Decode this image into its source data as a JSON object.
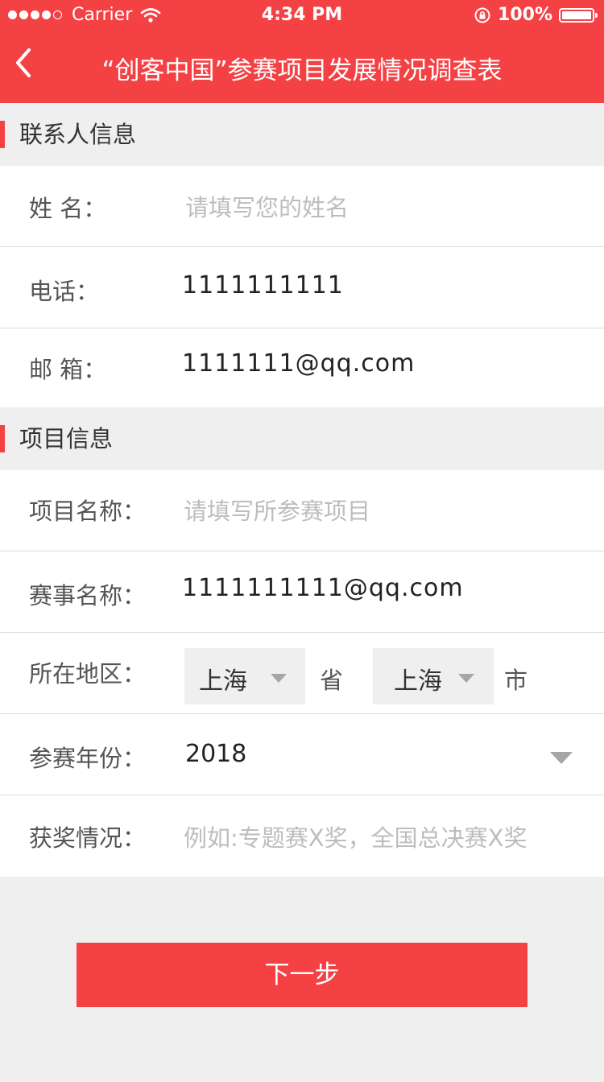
{
  "status_bar": {
    "carrier": "Carrier",
    "time": "4:34 PM",
    "battery": "100%"
  },
  "nav": {
    "title": "“创客中国”参赛项目发展情况调查表"
  },
  "contact_section": {
    "title": "联系人信息",
    "name_label": "姓 名：",
    "name_placeholder": "请填写您的姓名",
    "phone_label": "电话：",
    "phone_value": "1111111111",
    "email_label": "邮 箱：",
    "email_value": "1111111@qq.com"
  },
  "project_section": {
    "title": "项目信息",
    "project_name_label": "项目名称：",
    "project_name_placeholder": "请填写所参赛项目",
    "event_name_label": "赛事名称：",
    "event_name_value": "1111111111@qq.com",
    "region_label": "所在地区：",
    "province_value": "上海",
    "province_unit": "省",
    "city_value": "上海",
    "city_unit": "市",
    "year_label": "参赛年份：",
    "year_value": "2018",
    "award_label": "获奖情况：",
    "award_placeholder": "例如:专题赛X奖，全国总决赛X奖"
  },
  "next_button": "下一步",
  "colors": {
    "accent": "#f44144",
    "background": "#efefef"
  }
}
